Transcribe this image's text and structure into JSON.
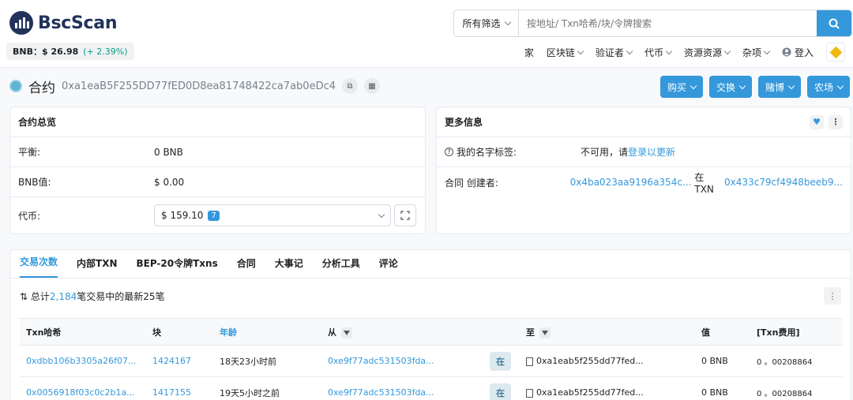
{
  "header": {
    "logo_text": "BscScan",
    "price_label": "BNB：$ 26.98",
    "price_change": "(+ 2.39%)",
    "filter_label": "所有筛选",
    "search_placeholder": "按地址/ Txn哈希/块/令牌搜索",
    "nav": [
      {
        "label": "家"
      },
      {
        "label": "区块链"
      },
      {
        "label": "验证者"
      },
      {
        "label": "代币"
      },
      {
        "label": "资源资源"
      },
      {
        "label": "杂项"
      },
      {
        "label": "登入"
      }
    ]
  },
  "page": {
    "title": "合约",
    "address": "0xa1eaB5F255DD77fED0D8ea81748422ca7ab0eDc4",
    "actions": [
      "购买",
      "交换",
      "赌博",
      "农场"
    ]
  },
  "overview": {
    "title": "合约总览",
    "balance_label": "平衡:",
    "balance_value": "0 BNB",
    "value_label": "BNB值:",
    "value_value": "$ 0.00",
    "token_label": "代币:",
    "token_value": "$ 159.10",
    "token_count": "7"
  },
  "more_info": {
    "title": "更多信息",
    "tag_label": "我的名字标签:",
    "tag_value": "不可用，请",
    "tag_link": "登录以更新",
    "creator_label": "合同 创建者:",
    "creator_address": "0x4ba023aa9196a354c...",
    "creator_at": "在TXN",
    "creator_txn": "0x433c79cf4948beeb9..."
  },
  "tabs": [
    "交易次数",
    "内部TXN",
    "BEP-20令牌Txns",
    "合同",
    "大事记",
    "分析工具",
    "评论"
  ],
  "summary": {
    "prefix": "总计",
    "count": "2,184",
    "suffix": "笔交易中的最新25笔"
  },
  "table": {
    "headers": [
      "Txn哈希",
      "块",
      "年龄",
      "从",
      "",
      "至",
      "值",
      "[Txn费用]"
    ],
    "rows": [
      {
        "hash": "0xdbb106b3305a26f07...",
        "block": "1424167",
        "age": "18天23小时前",
        "from": "0xe9f77adc531503fda...",
        "dir": "在",
        "to": "0xa1eab5f255dd77fed...",
        "value": "0 BNB",
        "fee": "0 。00208864"
      },
      {
        "hash": "0x0056918f03c0c2b1a...",
        "block": "1417155",
        "age": "19天5小时之前",
        "from": "0xe9f77adc531503fda...",
        "dir": "在",
        "to": "0xa1eab5f255dd77fed...",
        "value": "0 BNB",
        "fee": "0 。00208864"
      }
    ]
  }
}
